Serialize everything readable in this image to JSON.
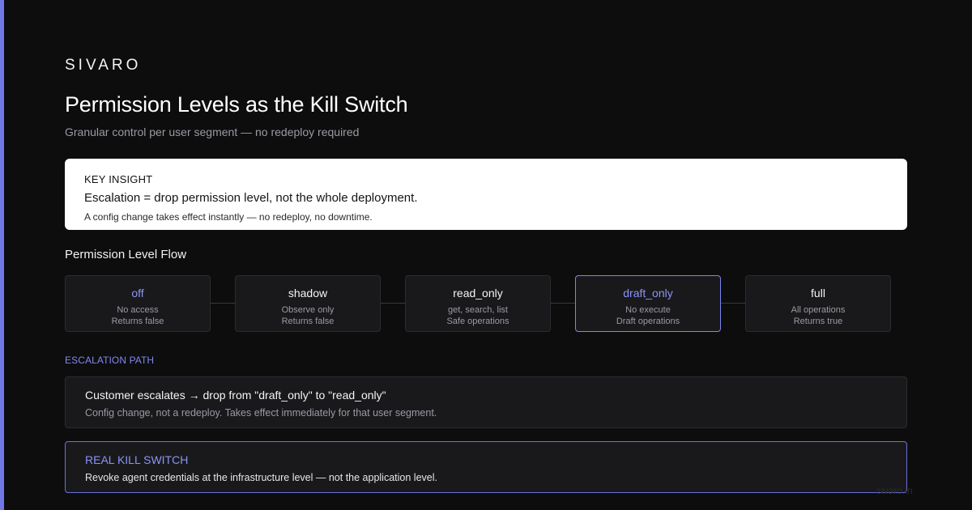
{
  "brand": "SIVARO",
  "title": "Permission Levels as the Kill Switch",
  "subtitle": "Granular control per user segment — no redeploy required",
  "insight": {
    "label": "KEY INSIGHT",
    "text": "Escalation = drop permission level, not the whole deployment.",
    "sub": "A config change takes effect instantly — no redeploy, no downtime."
  },
  "flow": {
    "title": "Permission Level Flow",
    "nodes": [
      {
        "name": "off",
        "line1": "No access",
        "line2": "Returns false"
      },
      {
        "name": "shadow",
        "line1": "Observe only",
        "line2": "Returns false"
      },
      {
        "name": "read_only",
        "line1": "get, search, list",
        "line2": "Safe operations"
      },
      {
        "name": "draft_only",
        "line1": "No execute",
        "line2": "Draft operations"
      },
      {
        "name": "full",
        "line1": "All operations",
        "line2": "Returns true"
      }
    ]
  },
  "escalation": {
    "label": "ESCALATION PATH",
    "head": "Customer escalates → drop from \"draft_only\" to \"read_only\"",
    "body": "Config change, not a redeploy. Takes effect immediately for that user segment."
  },
  "kill_switch": {
    "head": "REAL KILL SWITCH",
    "body": "Revoke agent credentials at the infrastructure level — not the application level."
  },
  "watermark": "sivaro.in",
  "colors": {
    "background": "#0d0d0e",
    "accent": "#7c86f0",
    "card": "#19191c"
  }
}
